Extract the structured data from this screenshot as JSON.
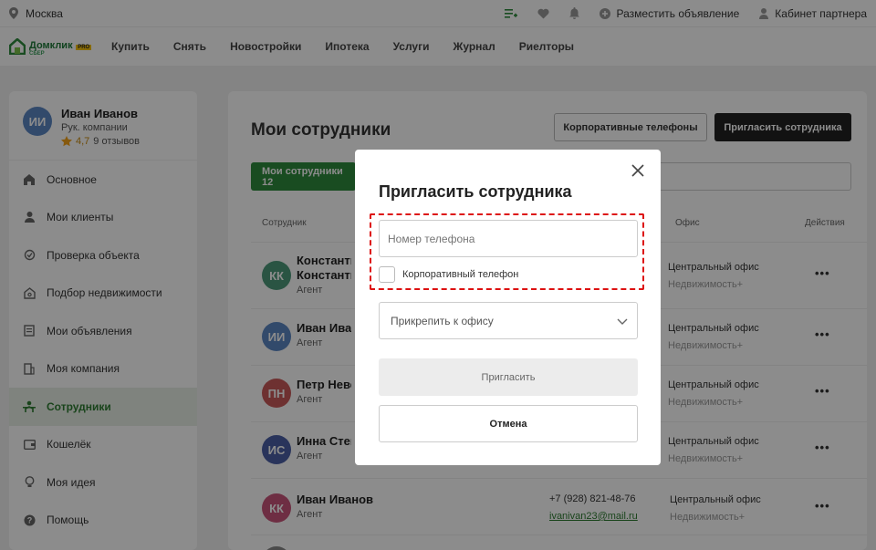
{
  "topbar": {
    "city": "Москва",
    "post_ad": "Разместить объявление",
    "partner_cabinet": "Кабинет партнера"
  },
  "navbar": {
    "logo_text": "Домклик",
    "logo_badge": "PRO",
    "logo_sub": "СБЕР",
    "items": [
      "Купить",
      "Снять",
      "Новостройки",
      "Ипотека",
      "Услуги",
      "Журнал",
      "Риелторы"
    ]
  },
  "profile": {
    "initials": "ИИ",
    "name": "Иван Иванов",
    "role": "Рук. компании",
    "rating": "4,7",
    "reviews": "9 отзывов"
  },
  "sidebar": {
    "items": [
      {
        "label": "Основное",
        "icon": "home-icon"
      },
      {
        "label": "Мои клиенты",
        "icon": "user-icon"
      },
      {
        "label": "Проверка объекта",
        "icon": "check-object-icon"
      },
      {
        "label": "Подбор недвижимости",
        "icon": "house-search-icon"
      },
      {
        "label": "Мои объявления",
        "icon": "listing-icon"
      },
      {
        "label": "Моя компания",
        "icon": "company-icon"
      },
      {
        "label": "Сотрудники",
        "icon": "employees-icon"
      },
      {
        "label": "Кошелёк",
        "icon": "wallet-icon"
      },
      {
        "label": "Моя идея",
        "icon": "idea-icon"
      },
      {
        "label": "Помощь",
        "icon": "help-icon"
      }
    ],
    "active_index": 6
  },
  "main": {
    "title": "Мои сотрудники",
    "corp_phones_button": "Корпоративные телефоны",
    "invite_button": "Пригласить сотрудника",
    "tab_label": "Мои сотрудники 12",
    "col_employee": "Сотрудник",
    "col_office": "Офис",
    "col_actions": "Действия",
    "rows": [
      {
        "initials": "КК",
        "name": "Константин Константинов",
        "role": "Агент",
        "office": "Центральный офис",
        "office2": "Недвижимость+",
        "color": "#4e9a7b",
        "phone": "",
        "email": ""
      },
      {
        "initials": "ИИ",
        "name": "Иван Иванов",
        "role": "Агент",
        "office": "Центральный офис",
        "office2": "Недвижимость+",
        "color": "#5c88c4",
        "phone": "",
        "email": ""
      },
      {
        "initials": "ПН",
        "name": "Петр Невский",
        "role": "Агент",
        "office": "Центральный офис",
        "office2": "Недвижимость+",
        "color": "#c95a5a",
        "phone": "",
        "email": ""
      },
      {
        "initials": "ИС",
        "name": "Инна Степанова",
        "role": "Агент",
        "office": "Центральный офис",
        "office2": "Недвижимость+",
        "color": "#4b5fa6",
        "phone": "",
        "email": ""
      },
      {
        "initials": "КК",
        "name": "Иван Иванов",
        "role": "Агент",
        "office": "Центральный офис",
        "office2": "Недвижимость+",
        "color": "#c9557a",
        "phone": "+7 (928) 821-48-76",
        "email": "ivanivan23@mail.ru"
      }
    ]
  },
  "modal": {
    "title": "Пригласить сотрудника",
    "phone_placeholder": "Номер телефона",
    "corp_phone_checkbox": "Корпоративный телефон",
    "office_select": "Прикрепить к офису",
    "send_button": "Пригласить",
    "cancel_button": "Отмена"
  },
  "colors": {
    "accent_green": "#2e8b3d",
    "highlight_red": "#dd1111",
    "star": "#f4a21b"
  }
}
